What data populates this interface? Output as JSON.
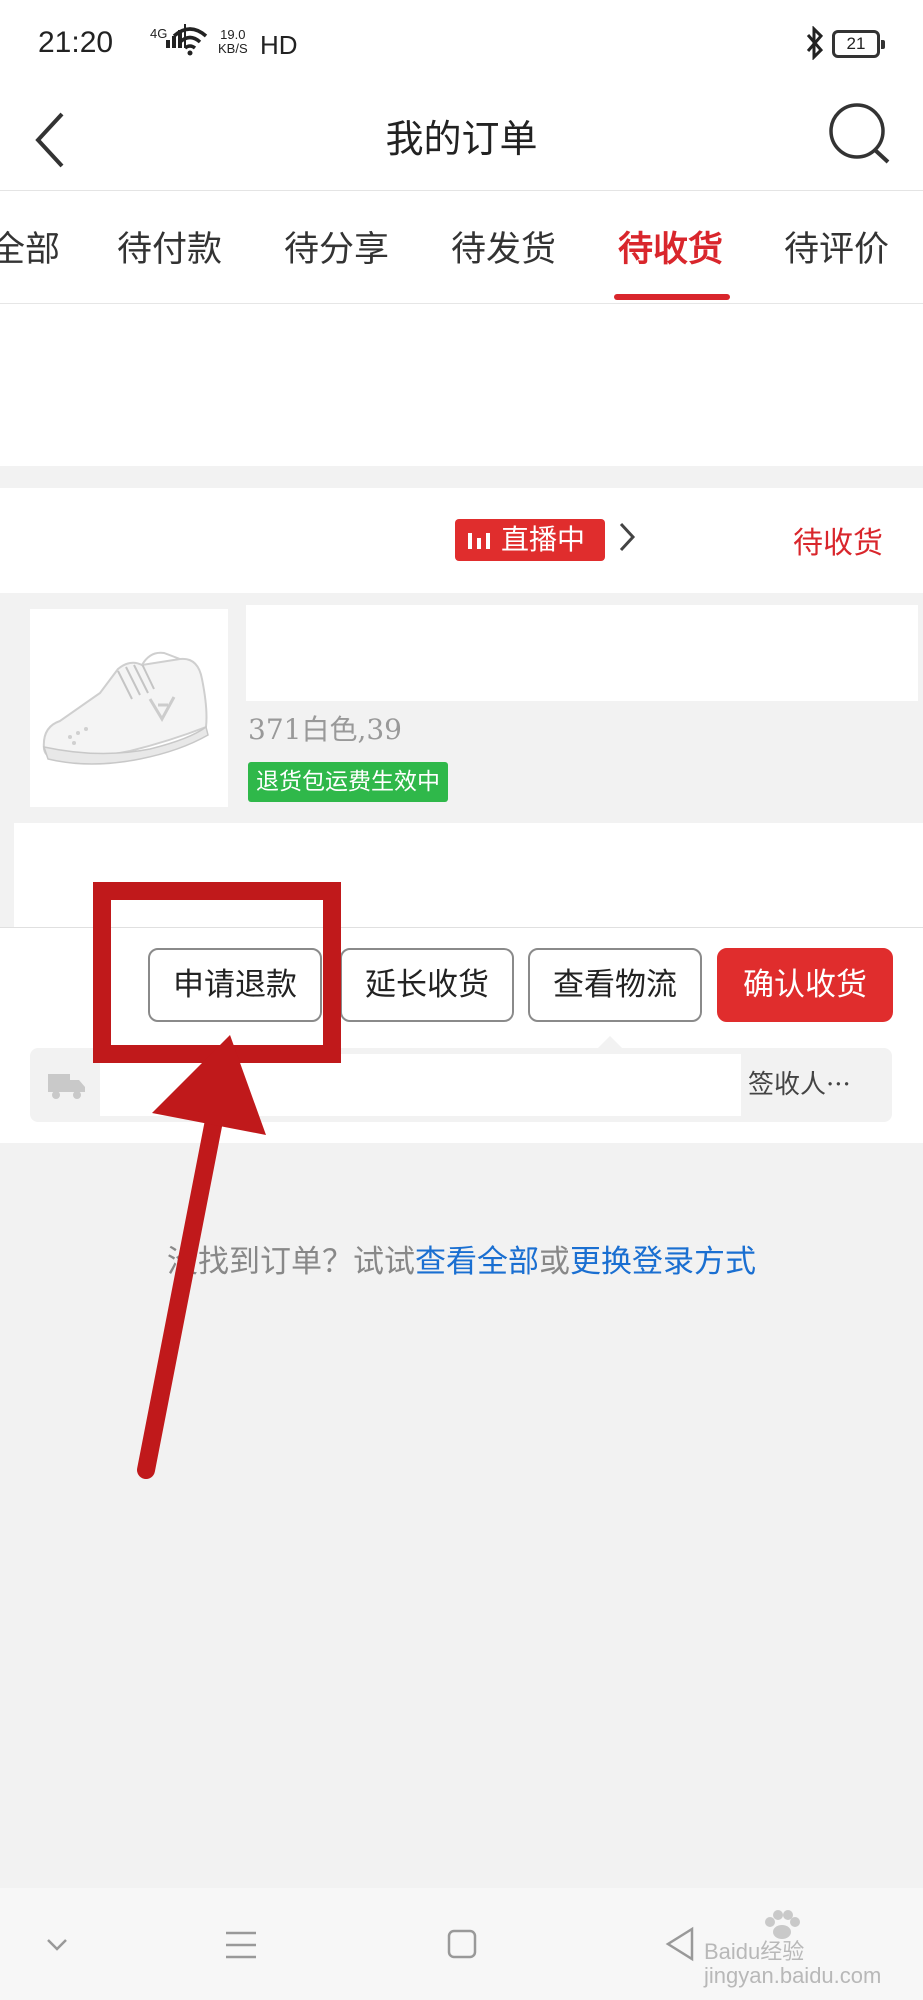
{
  "status_bar": {
    "time": "21:20",
    "network": "4G",
    "speed_value": "19.0",
    "speed_unit": "KB/S",
    "hd": "HD",
    "battery": "21"
  },
  "header": {
    "title": "我的订单"
  },
  "tabs": [
    {
      "label": "全部"
    },
    {
      "label": "待付款"
    },
    {
      "label": "待分享"
    },
    {
      "label": "待发货"
    },
    {
      "label": "待收货",
      "active": true
    },
    {
      "label": "待评价"
    }
  ],
  "order": {
    "live_badge": "直播中",
    "status": "待收货",
    "sku": "371白色,39",
    "tag": "退货包运费生效中",
    "actions": {
      "refund": "申请退款",
      "extend": "延长收货",
      "logistics": "查看物流",
      "confirm": "确认收货"
    },
    "logistics_signer": "签收人···"
  },
  "empty_hint": {
    "prefix": "没找到订单？试试",
    "link1": "查看全部",
    "middle": "或",
    "link2": "更换登录方式"
  },
  "watermark": "Baidu经验 jingyan.baidu.com",
  "colors": {
    "accent": "#d9262c",
    "green_tag": "#2fb84a",
    "link": "#1a6fd1",
    "annotation": "#c0191b"
  }
}
